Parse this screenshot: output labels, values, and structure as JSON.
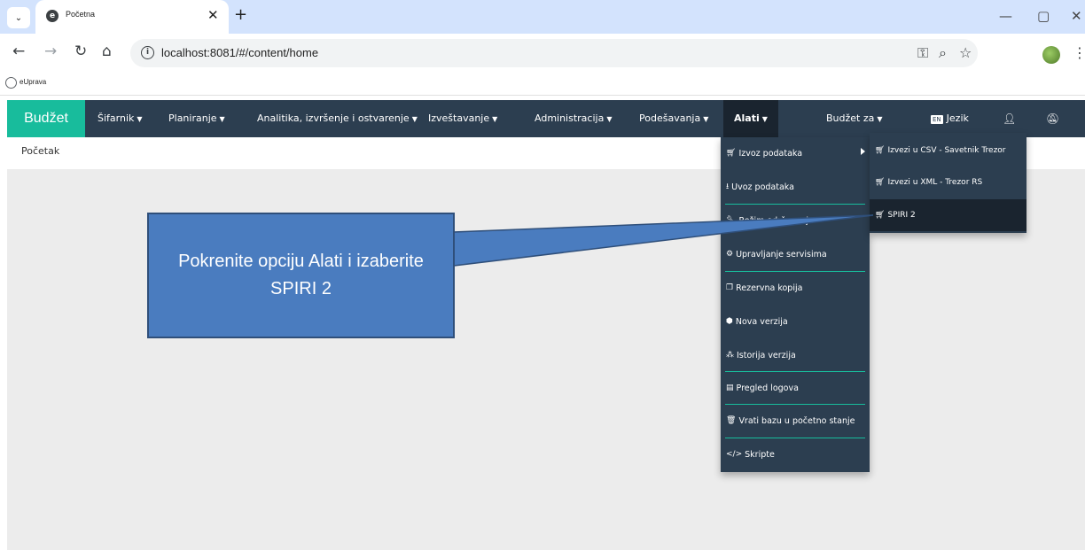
{
  "browser": {
    "tab_title": "Početna",
    "tab_close": "✕",
    "new_tab": "+",
    "url": "localhost:8081/#/content/home",
    "bookmark_label": "eUprava",
    "window_controls": [
      "—",
      "▢",
      "✕"
    ]
  },
  "app": {
    "brand": "Budžet",
    "nav": [
      {
        "label": "Šifarnik"
      },
      {
        "label": "Planiranje"
      },
      {
        "label": "Analitika, izvršenje i ostvarenje"
      },
      {
        "label": "Izveštavanje"
      },
      {
        "label": "Administracija"
      },
      {
        "label": "Podešavanja"
      },
      {
        "label": "Alati"
      }
    ],
    "right_nav": {
      "budzet_za": "Budžet za",
      "jezik": "Jezik"
    },
    "breadcrumb": "Početak"
  },
  "alati_menu": {
    "items": [
      {
        "label": "Izvoz podataka",
        "icon": "cart-icon"
      },
      {
        "label": "Uvoz podataka",
        "icon": "download-icon"
      },
      {
        "label": "Režim održavanja",
        "icon": "wrench-icon"
      },
      {
        "label": "Upravljanje servisima",
        "icon": "cogs-icon"
      },
      {
        "label": "Rezervna kopija",
        "icon": "copy-icon"
      },
      {
        "label": "Nova verzija",
        "icon": "cube-icon"
      },
      {
        "label": "Istorija verzija",
        "icon": "cubes-icon"
      },
      {
        "label": "Pregled logova",
        "icon": "clipboard-icon"
      },
      {
        "label": "Vrati bazu u početno stanje",
        "icon": "trash-icon"
      },
      {
        "label": "Skripte",
        "icon": "code-icon"
      }
    ]
  },
  "izvoz_submenu": {
    "items": [
      {
        "label": "Izvezi u CSV - Savetnik Trezor"
      },
      {
        "label": "Izvezi u XML - Trezor RS"
      },
      {
        "label": "SPIRI 2"
      }
    ]
  },
  "callout": {
    "text": "Pokrenite opciju Alati i izaberite SPIRI 2"
  },
  "colors": {
    "navbar": "#2c3e50",
    "brand": "#18bc9c",
    "callout": "#4a7cbf"
  }
}
